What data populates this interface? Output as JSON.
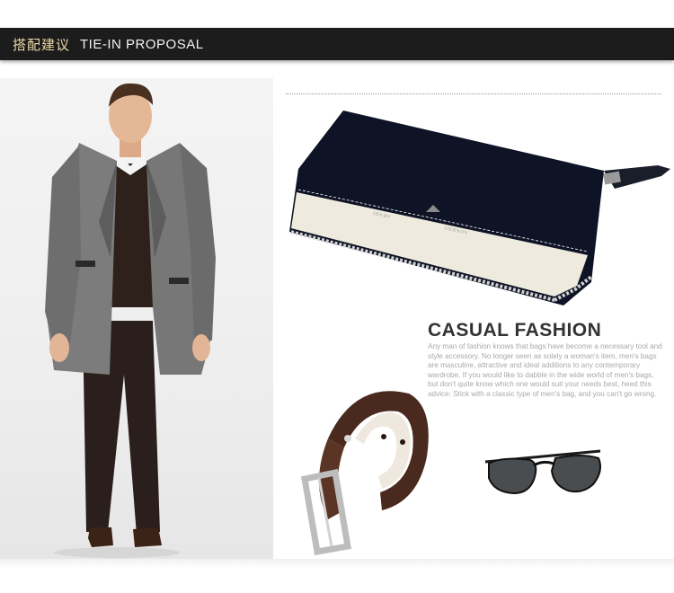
{
  "header": {
    "title_zh": "搭配建议",
    "title_en": "TIE-IN PROPOSAL"
  },
  "wallet": {
    "brand_left": "INVRV",
    "brand_right": "JIEDSOV"
  },
  "casual_fashion": {
    "title": "CASUAL FASHION",
    "body": "Any man of fashion knows that bags have become a necessary tool and style accessory. No longer seen as solely a woman's item, men's bags are masculine, attractive and ideal additions to any contemporary wardrobe. If you would like to dabble in the wide world of men's bags, but don't quite know which one would suit your needs best, heed this advice: Stick with a classic type of men's bag, and you can't go wrong."
  },
  "colors": {
    "banner_bg": "#1c1c1c",
    "banner_zh_text": "#e9d8a6",
    "wallet_navy": "#0e1426",
    "wallet_cream": "#efeade",
    "belt_brown": "#4a2a1e"
  },
  "images": {
    "model": "man-in-grey-coat",
    "wallet": "zip-around-wallet",
    "belt": "woven-leather-belt",
    "sunglasses": "aviator-sunglasses"
  }
}
